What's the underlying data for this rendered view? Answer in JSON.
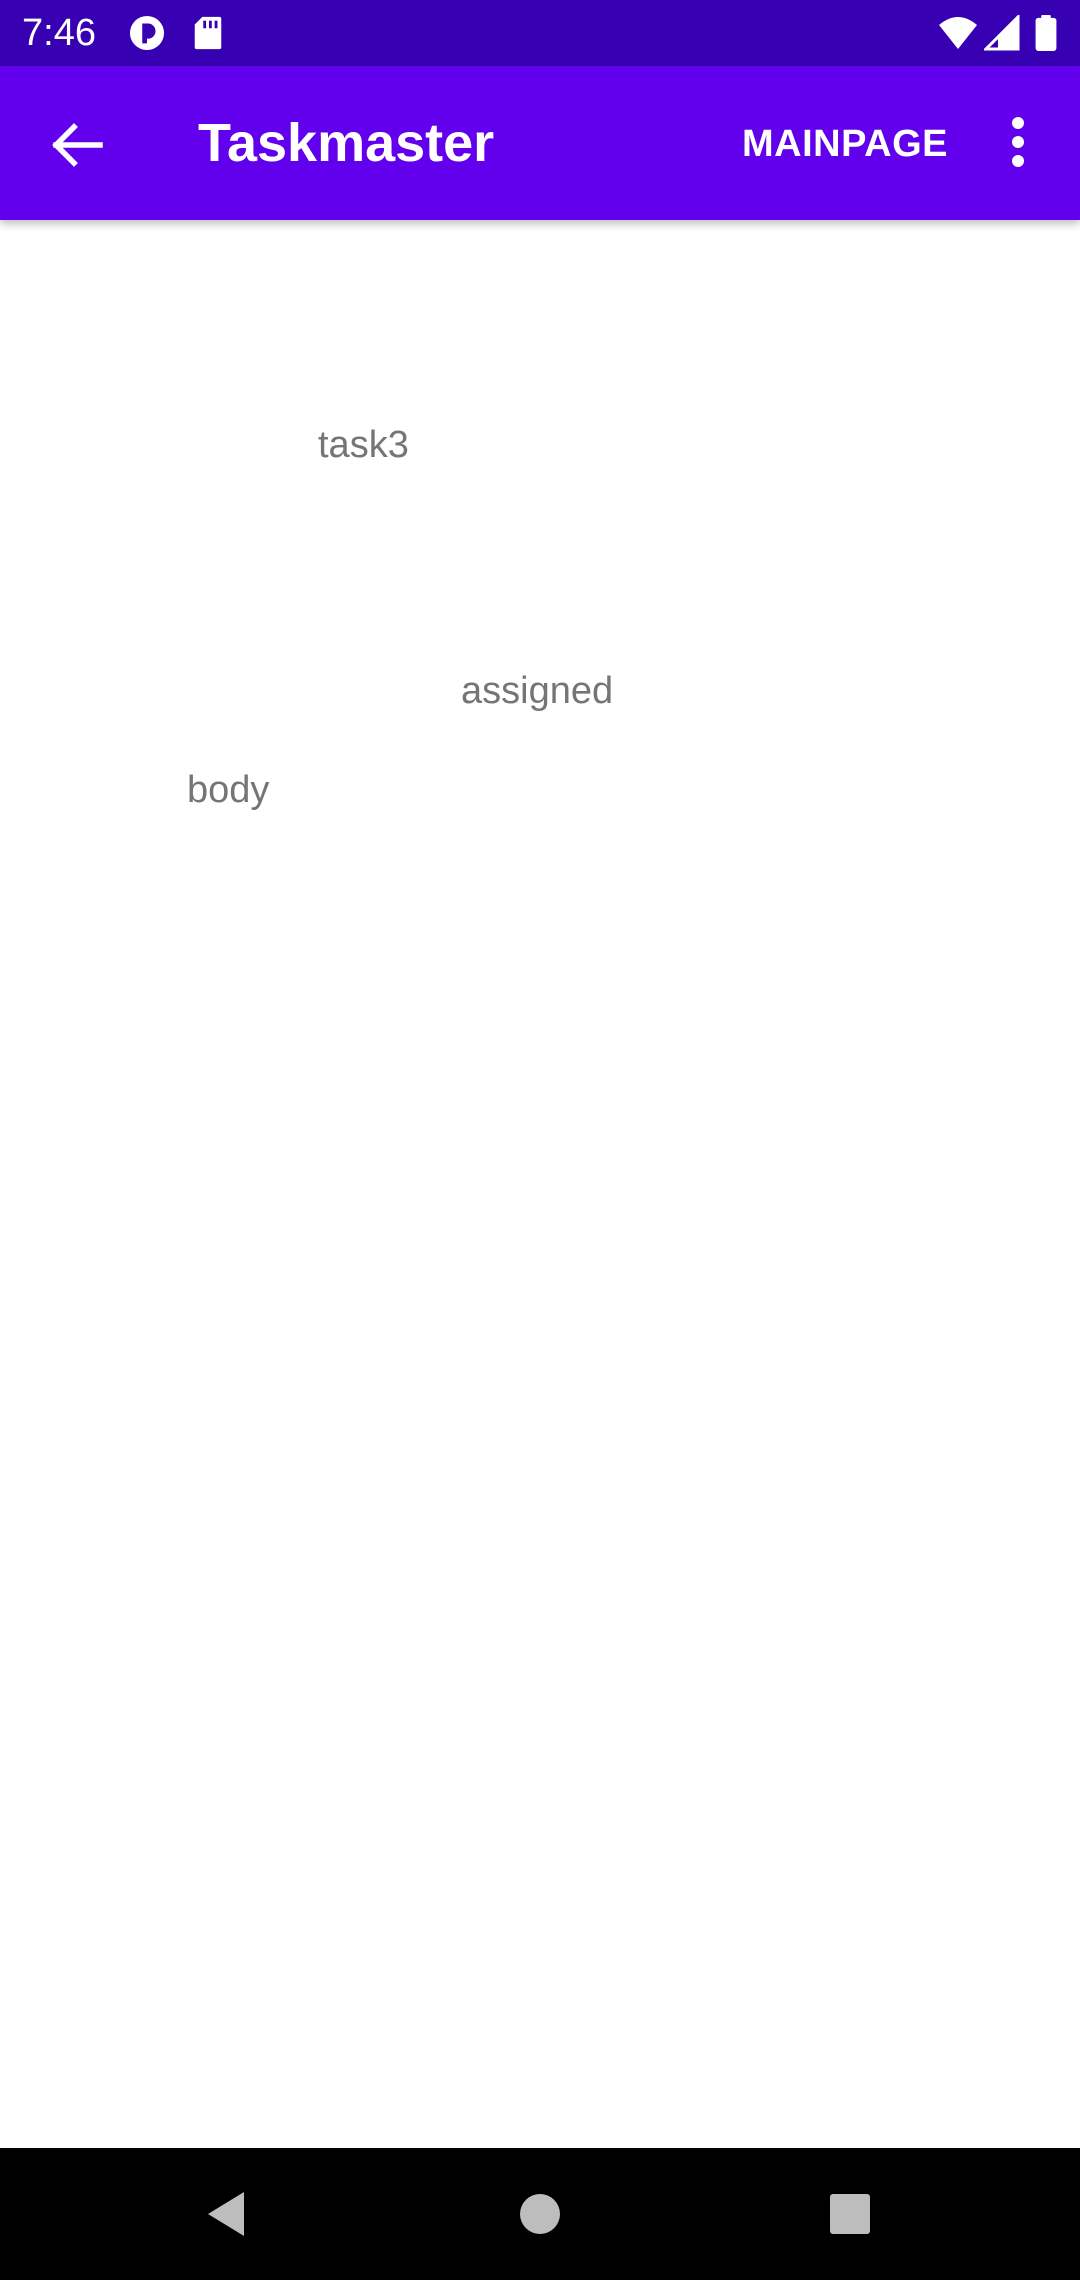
{
  "status_bar": {
    "time": "7:46",
    "icons": [
      "notification-app-icon",
      "sd-card-icon",
      "wifi-icon",
      "cell-signal-icon",
      "battery-icon"
    ]
  },
  "app_bar": {
    "title": "Taskmaster",
    "action_label": "MAINPAGE",
    "icons": [
      "back-arrow-icon",
      "overflow-menu-icon"
    ]
  },
  "task": {
    "title": "task3",
    "state": "assigned",
    "body": "body"
  },
  "nav_bar": {
    "icons": [
      "back-triangle-icon",
      "home-circle-icon",
      "recents-square-icon"
    ]
  },
  "colors": {
    "status_bar": "#3700b3",
    "app_bar": "#6200ee",
    "content_text": "#757575",
    "nav_bar": "#000000"
  }
}
